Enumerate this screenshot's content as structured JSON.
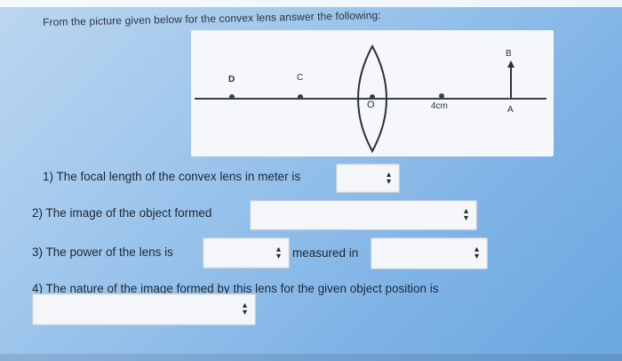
{
  "prompt": "From the picture given below for the convex lens answer the following:",
  "diagram": {
    "labels": {
      "d": "D",
      "c": "C",
      "o": "O",
      "distance": "4cm",
      "b": "B",
      "a": "A"
    }
  },
  "questions": {
    "q1": "1) The focal length of the convex lens in meter is",
    "q2": "2) The image of the object formed",
    "q3_prefix": "3) The power of the lens is",
    "q3_measured": "measured in",
    "q4": "4) The nature of the image formed by this lens for the given object position is"
  },
  "selects": {
    "focal_length": "",
    "image_formed": "",
    "power": "",
    "power_unit": "",
    "nature": ""
  },
  "icons": {
    "select_arrow": "up-down-chevron-icon"
  }
}
